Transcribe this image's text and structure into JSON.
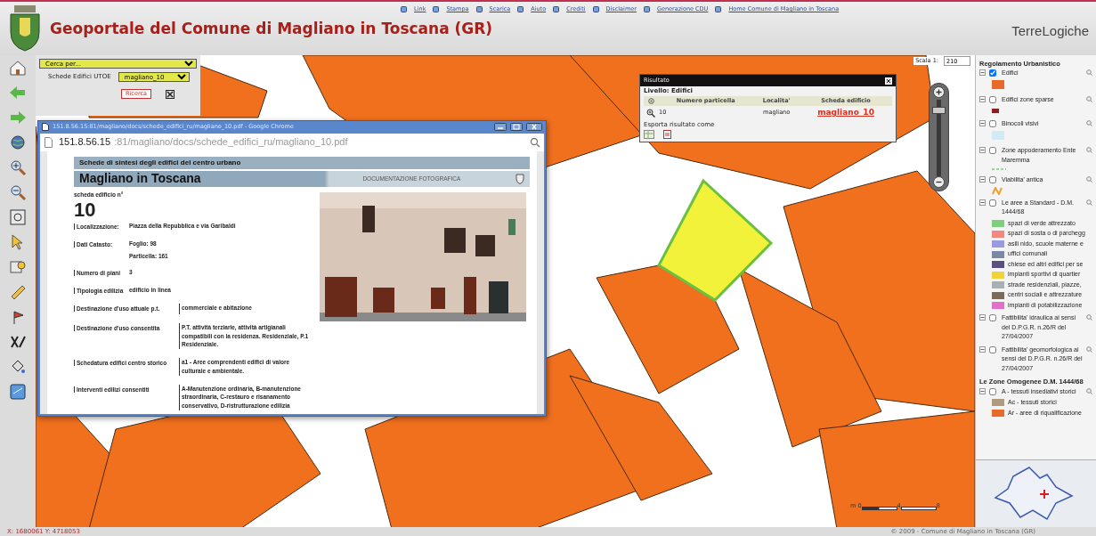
{
  "header": {
    "title": "Geoportale del Comune di Magliano in Toscana (GR)",
    "brand": "TerreLogiche",
    "links": [
      "Link",
      "Stampa",
      "Scarica",
      "Aiuto",
      "Crediti",
      "Disclaimer",
      "Generazione CDU",
      "Home Comune di Magliano in Toscana"
    ]
  },
  "search_panel": {
    "search_by": "Cerca per...",
    "field_label": "Schede Edifici UTOE",
    "utoe_value": "magliano_10",
    "search_button": "Ricerca"
  },
  "browser_window": {
    "title": "151.8.56.15:81/magliano/docs/schede_edifici_ru/magliano_10.pdf - Google Chrome",
    "url_host": "151.8.56.15",
    "url_path": ":81/magliano/docs/schede_edifici_ru/magliano_10.pdf",
    "document": {
      "banner": "Schede di sintesi degli edifici del centro urbano",
      "town": "Magliano in Toscana",
      "section": "DOCUMENTAZIONE FOTOGRAFICA",
      "number_label": "scheda edificio n°",
      "number": "10",
      "fields": [
        {
          "kind": "short",
          "label": "Localizzazione:",
          "value": "Piazza della Repubblica e via Garibaldi"
        },
        {
          "kind": "short",
          "label": "Dati Catasto:",
          "value": "Foglio: 98",
          "value_2": "Particella: 161"
        },
        {
          "kind": "short",
          "label": "Numero di piani",
          "value": "3"
        },
        {
          "kind": "short",
          "label": "Tipologia edilizia",
          "value": "edificio in linea"
        },
        {
          "kind": "long",
          "label": "Destinazione d'uso attuale p.t.",
          "value": "commerciale e abitazione"
        },
        {
          "kind": "long",
          "label": "Destinazione d'uso consentita",
          "value": "P.T. attività terziarie, attività artigianali compatibili con la residenza. Residenziale, P.1 Residenziale."
        },
        {
          "kind": "long",
          "label": "Schedatura edifici centro storico",
          "value": "a1 - Aree comprendenti edifici di valore culturale e ambientale."
        },
        {
          "kind": "long",
          "label": "Interventi edilizi consentiti",
          "value": "A-Manutenzione ordinaria, B-manutenzione straordinaria, C-restauro e risanamento conservativo, D-ristrutturazione edilizia"
        }
      ]
    }
  },
  "result_panel": {
    "title": "Risultato",
    "layer": "Livello: Edifici",
    "columns": [
      "Numero particella",
      "Localita'",
      "Scheda edificio"
    ],
    "rows": [
      {
        "cells": [
          "10",
          "magliano",
          "magliano_10"
        ]
      }
    ],
    "export_label": "Esporta risultato come"
  },
  "scale": {
    "label": "Scala 1:",
    "value": "210"
  },
  "zoom_slider": {
    "level": 0.9
  },
  "scale_bar": [
    "m 0",
    "4",
    "8"
  ],
  "legend": {
    "groups": [
      {
        "title": "Regolamento Urbanistico",
        "layers": [
          {
            "label": "Edifici",
            "checked": true,
            "kind": "swatch",
            "color": "#e8692a"
          },
          {
            "label": "Edifici zone sparse",
            "checked": false,
            "kind": "small_swatch",
            "color": "#8b1e1e"
          },
          {
            "label": "Binocoli visivi",
            "checked": false,
            "kind": "swatch",
            "color": "#d4eaf3"
          },
          {
            "label": "Zone appoderamento Ente Maremma",
            "checked": false,
            "kind": "dashes",
            "color": "#9ad69a"
          },
          {
            "label": "Viabilita' antica",
            "checked": false,
            "kind": "zigzag",
            "color": "#f0a030"
          },
          {
            "label": "Le aree a Standard - D.M. 1444/68",
            "checked": false,
            "kind": "classes",
            "classes": [
              {
                "label": "spazi di verde attrezzato",
                "color": "#7fcf7f"
              },
              {
                "label": "spazi di sosta o di parchegg",
                "color": "#f08a80"
              },
              {
                "label": "asili nido, scuole materne e",
                "color": "#9a9ae0"
              },
              {
                "label": "uffici comunali",
                "color": "#7a8aa6"
              },
              {
                "label": "chiese ed altri edifici per se",
                "color": "#5a5080"
              },
              {
                "label": "impianti sportivi di quartier",
                "color": "#f2d23a"
              },
              {
                "label": "strade residenziali, piazze,",
                "color": "#a9b0b4"
              },
              {
                "label": "centri sociali e attrezzature",
                "color": "#7a6a5a"
              },
              {
                "label": "impianti di potabilizzazione",
                "color": "#e070c8"
              }
            ]
          },
          {
            "label": "Fattibilita' idraulica ai sensi del D.P.G.R. n.26/R del 27/04/2007",
            "checked": false
          },
          {
            "label": "Fattibilita' geomorfologica ai sensi del D.P.G.R. n.26/R del 27/04/2007",
            "checked": false
          }
        ]
      },
      {
        "title": "Le Zone Omogenee D.M. 1444/68",
        "layers": [
          {
            "label": "A - tessuti insediativi storici",
            "checked": false,
            "kind": "classes",
            "classes": [
              {
                "label": "Ac - tessuti storici",
                "color": "#b09a80"
              },
              {
                "label": "Ar - aree di riqualificazione",
                "color": "#e8692a"
              }
            ]
          }
        ]
      }
    ]
  },
  "status_bar": {
    "coordinates": "X: 1680061  Y: 4718053",
    "copyright": "© 2009 - Comune di Magliano in Toscana (GR)"
  }
}
